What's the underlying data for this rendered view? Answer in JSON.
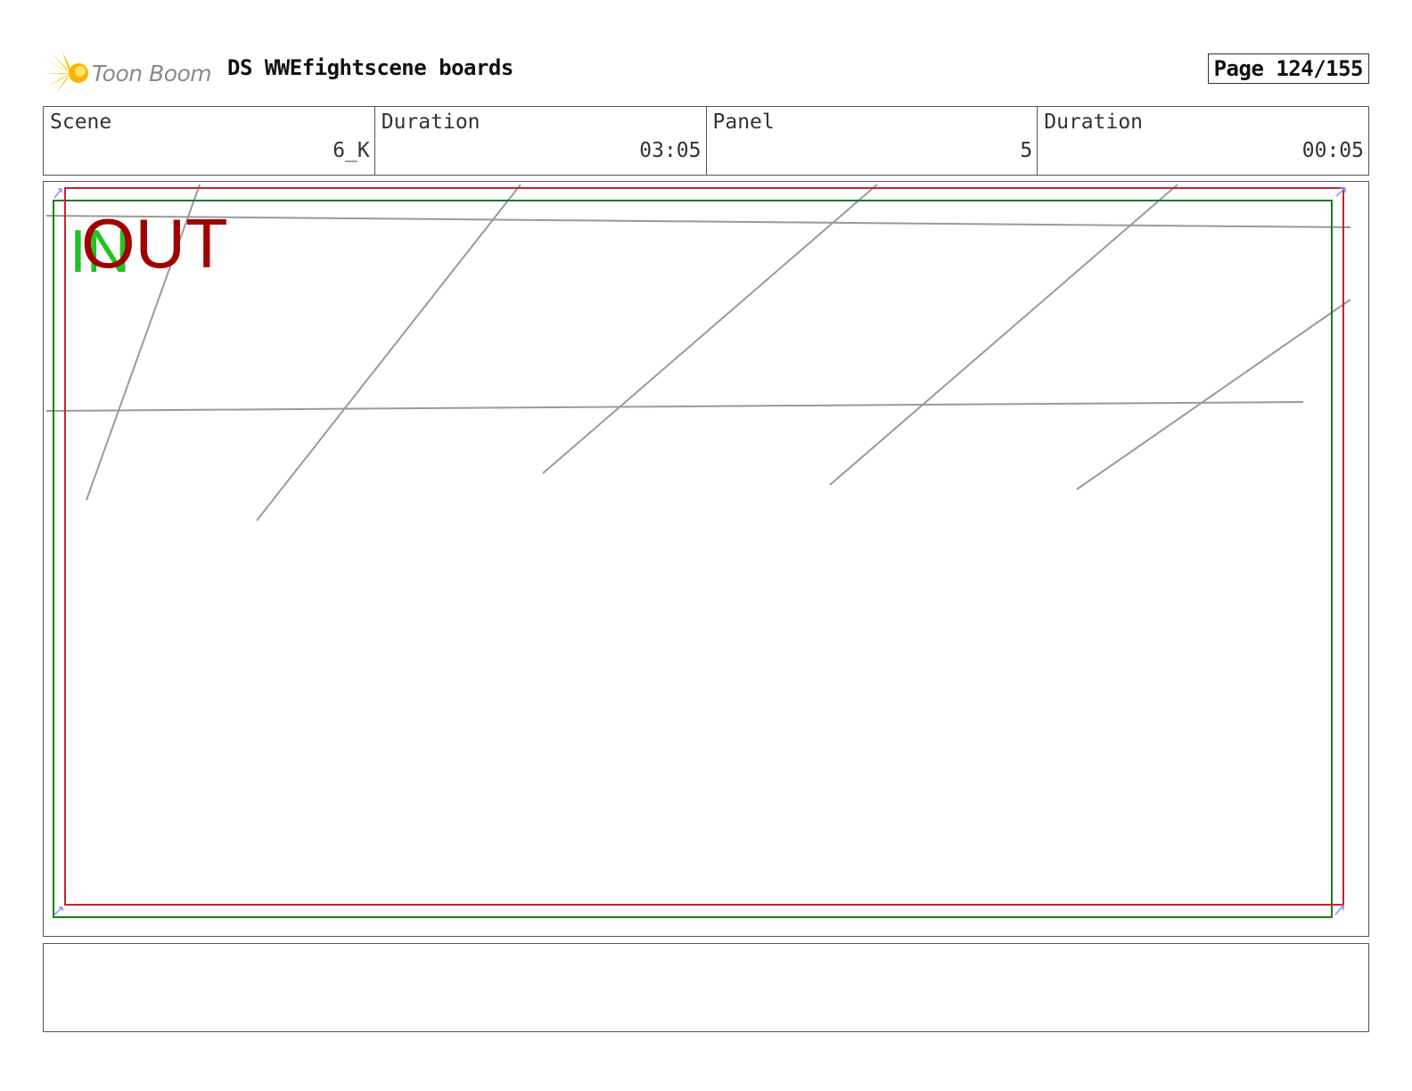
{
  "header": {
    "logo_text": "Toon Boom",
    "title": "DS WWEfightscene boards",
    "page": "Page 124/155"
  },
  "info": {
    "scene_label": "Scene",
    "scene_value": "6_K",
    "scene_duration_label": "Duration",
    "scene_duration_value": "03:05",
    "panel_label": "Panel",
    "panel_value": "5",
    "panel_duration_label": "Duration",
    "panel_duration_value": "00:05"
  },
  "panel": {
    "in_label": "IN",
    "out_label": "OUT",
    "colors": {
      "safe_frame": "#c0262b",
      "action_frame": "#1e7a1e",
      "sketch": "#9a9a9a",
      "in": "#1fc41f",
      "out": "#a00000"
    }
  },
  "notes": {
    "text": ""
  }
}
